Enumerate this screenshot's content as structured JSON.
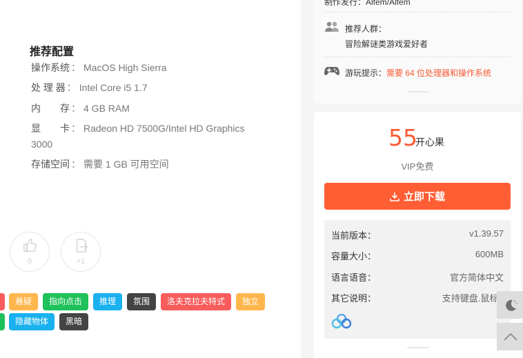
{
  "requirements": {
    "title": "推荐配置",
    "rows": [
      {
        "key": "操作系统",
        "value": "MacOS High Sierra"
      },
      {
        "key": "处 理 器",
        "value": "Intel Core i5 1.7"
      },
      {
        "key": "内　　存",
        "value": "4 GB RAM"
      },
      {
        "key": "显　　卡",
        "value": "Radeon HD 7500G/Intel HD Graphics"
      },
      {
        "key": "存储空间",
        "value": "需要 1 GB 可用空间"
      }
    ],
    "gpu_continuation": "3000",
    "separator": "："
  },
  "actions": {
    "like_count": "0",
    "share_count": "+1"
  },
  "tags": {
    "row1": [
      {
        "label": "悬疑",
        "color": "#ffb74d"
      },
      {
        "label": "指向点击",
        "color": "#1ec15a"
      },
      {
        "label": "推理",
        "color": "#1ab1ef"
      },
      {
        "label": "氛围",
        "color": "#444444"
      },
      {
        "label": "洛夫克拉夫特式",
        "color": "#f85c5c"
      },
      {
        "label": "独立",
        "color": "#ffb74d"
      }
    ],
    "row2": [
      {
        "label": "隐藏物体",
        "color": "#1ab1ef"
      },
      {
        "label": "黑暗",
        "color": "#444444"
      }
    ]
  },
  "info": {
    "publisher": "制作发行：Alfem/Alfem",
    "audience_label": "推荐人群：",
    "audience_value": "冒险解谜类游戏爱好者",
    "tip_label": "游玩提示：",
    "tip_value": "需要 64 位处理器和操作系统"
  },
  "price": {
    "amount": "55",
    "unit": "开心果",
    "vip": "VIP免费",
    "download": "立即下载"
  },
  "details": [
    {
      "label": "当前版本：",
      "value": "v1.39.57"
    },
    {
      "label": "容量大小：",
      "value": "600MB"
    },
    {
      "label": "语言语音：",
      "value": "官方简体中文"
    },
    {
      "label": "其它说明：",
      "value": "支持键盘.鼠标.手柄"
    }
  ],
  "colors": {
    "accent": "#ff5d33",
    "price": "#f75b33",
    "tip": "#f75b33"
  }
}
